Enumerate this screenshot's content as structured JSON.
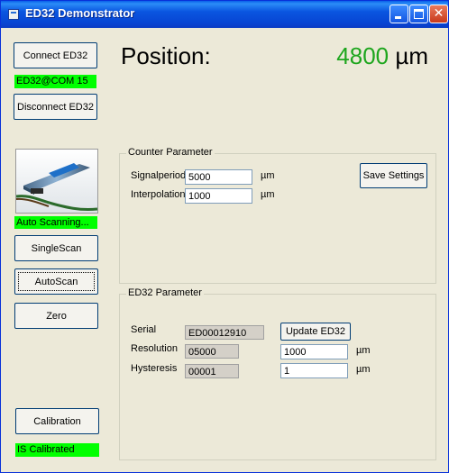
{
  "window": {
    "title": "ED32 Demonstrator"
  },
  "connection": {
    "connect_label": "Connect ED32",
    "status_text": "ED32@COM 15",
    "disconnect_label": "Disconnect ED32"
  },
  "position": {
    "label": "Position:",
    "value": "4800",
    "unit": "µm"
  },
  "scan": {
    "status_text": "Auto Scanning...",
    "single_scan_label": "SingleScan",
    "auto_scan_label": "AutoScan",
    "zero_label": "Zero"
  },
  "calibration": {
    "button_label": "Calibration",
    "status_text": "IS Calibrated"
  },
  "counter_parameter": {
    "title": "Counter Parameter",
    "signalperiod_label": "Signalperiod",
    "signalperiod_value": "5000",
    "signalperiod_unit": "µm",
    "interpolation_label": "Interpolation",
    "interpolation_value": "1000",
    "interpolation_unit": "µm",
    "save_label": "Save Settings"
  },
  "ed32_parameter": {
    "title": "ED32 Parameter",
    "serial_label": "Serial",
    "serial_value": "ED00012910",
    "update_label": "Update ED32",
    "resolution_label": "Resolution",
    "resolution_value": "05000",
    "resolution_input": "1000",
    "resolution_unit": "µm",
    "hysteresis_label": "Hysteresis",
    "hysteresis_value": "00001",
    "hysteresis_input": "1",
    "hysteresis_unit": "µm"
  },
  "colors": {
    "status_green": "#00ff00",
    "position_value": "#1ea61e",
    "titlebar": "#0a55e0"
  },
  "icons": {
    "app": "app-window-icon",
    "minimize": "minimize-icon",
    "maximize": "maximize-icon",
    "close": "close-icon"
  }
}
